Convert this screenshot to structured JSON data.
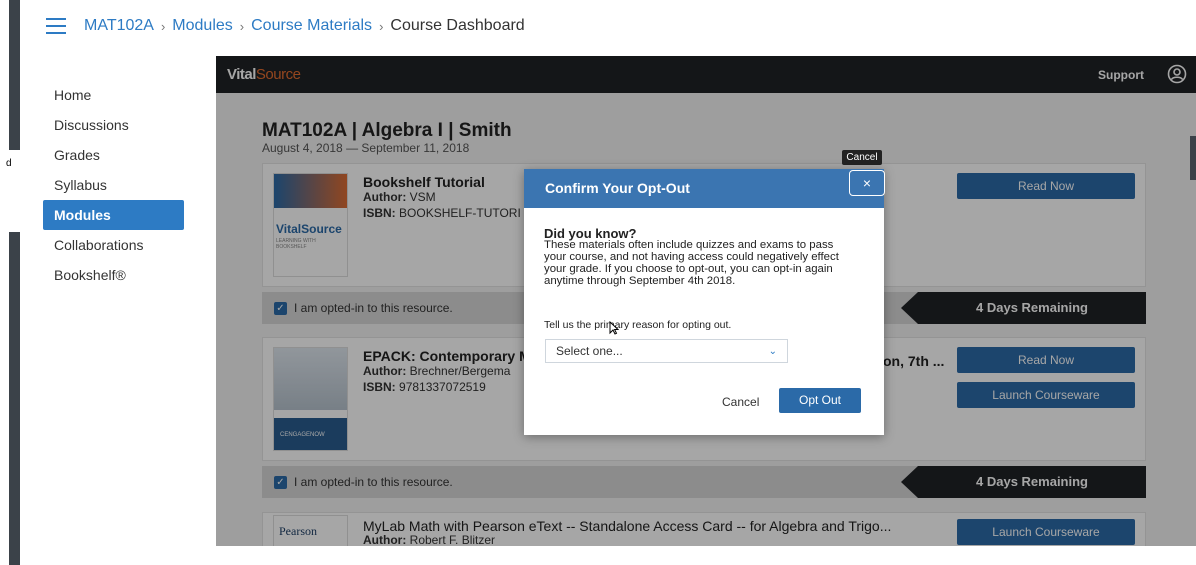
{
  "left_fragments": [
    "d"
  ],
  "breadcrumb": {
    "items": [
      "MAT102A",
      "Modules",
      "Course Materials",
      "Course Dashboard"
    ]
  },
  "nav": {
    "items": [
      "Home",
      "Discussions",
      "Grades",
      "Syllabus",
      "Modules",
      "Collaborations",
      "Bookshelf®"
    ],
    "active": "Modules"
  },
  "app": {
    "logo_bold": "Vital",
    "logo_light": "Source",
    "support_label": "Support",
    "course_title": "MAT102A | Algebra I | Smith",
    "course_dates": "August 4, 2018 — September 11, 2018",
    "books": [
      {
        "title": "Bookshelf Tutorial",
        "author_label": "Author:",
        "author": "VSM",
        "isbn_label": "ISBN:",
        "isbn": "BOOKSHELF-TUTORI",
        "cover_text": "VitalSource",
        "cover_sub": "LEARNING WITH BOOKSHELF",
        "buttons": [
          "Read Now"
        ],
        "status": "I am opted-in to this resource.",
        "days_remaining": "4 Days Remaining"
      },
      {
        "title": "EPACK: Contemporary M",
        "title_right": "on, 7th ...",
        "author_label": "Author:",
        "author": "Brechner/Bergema",
        "isbn_label": "ISBN:",
        "isbn": "9781337072519",
        "cover_text": "CENGAGENOW",
        "buttons": [
          "Read Now",
          "Launch Courseware"
        ],
        "status": "I am opted-in to this resource.",
        "days_remaining": "4 Days Remaining"
      },
      {
        "title": "MyLab Math with Pearson eText -- Standalone Access Card -- for Algebra and Trigo...",
        "author_label": "Author:",
        "author": "Robert F. Blitzer",
        "cover_text": "Pearson",
        "buttons": [
          "Launch Courseware"
        ]
      }
    ]
  },
  "modal": {
    "title": "Confirm Your Opt-Out",
    "close_tooltip": "Cancel",
    "close_glyph": "×",
    "heading": "Did you know?",
    "body": "These materials often include quizzes and exams to pass your course, and not having access could negatively effect your grade. If you choose to opt-out, you can opt-in again anytime through September 4th 2018.",
    "reason_label": "Tell us the primary reason for opting out.",
    "select_value": "Select one...",
    "cancel_label": "Cancel",
    "opt_out_label": "Opt Out"
  },
  "colors": {
    "accent": "#2d7bc4",
    "button": "#2b6aa8",
    "modal_header": "#3b75b1",
    "topbar": "#1f2226"
  }
}
